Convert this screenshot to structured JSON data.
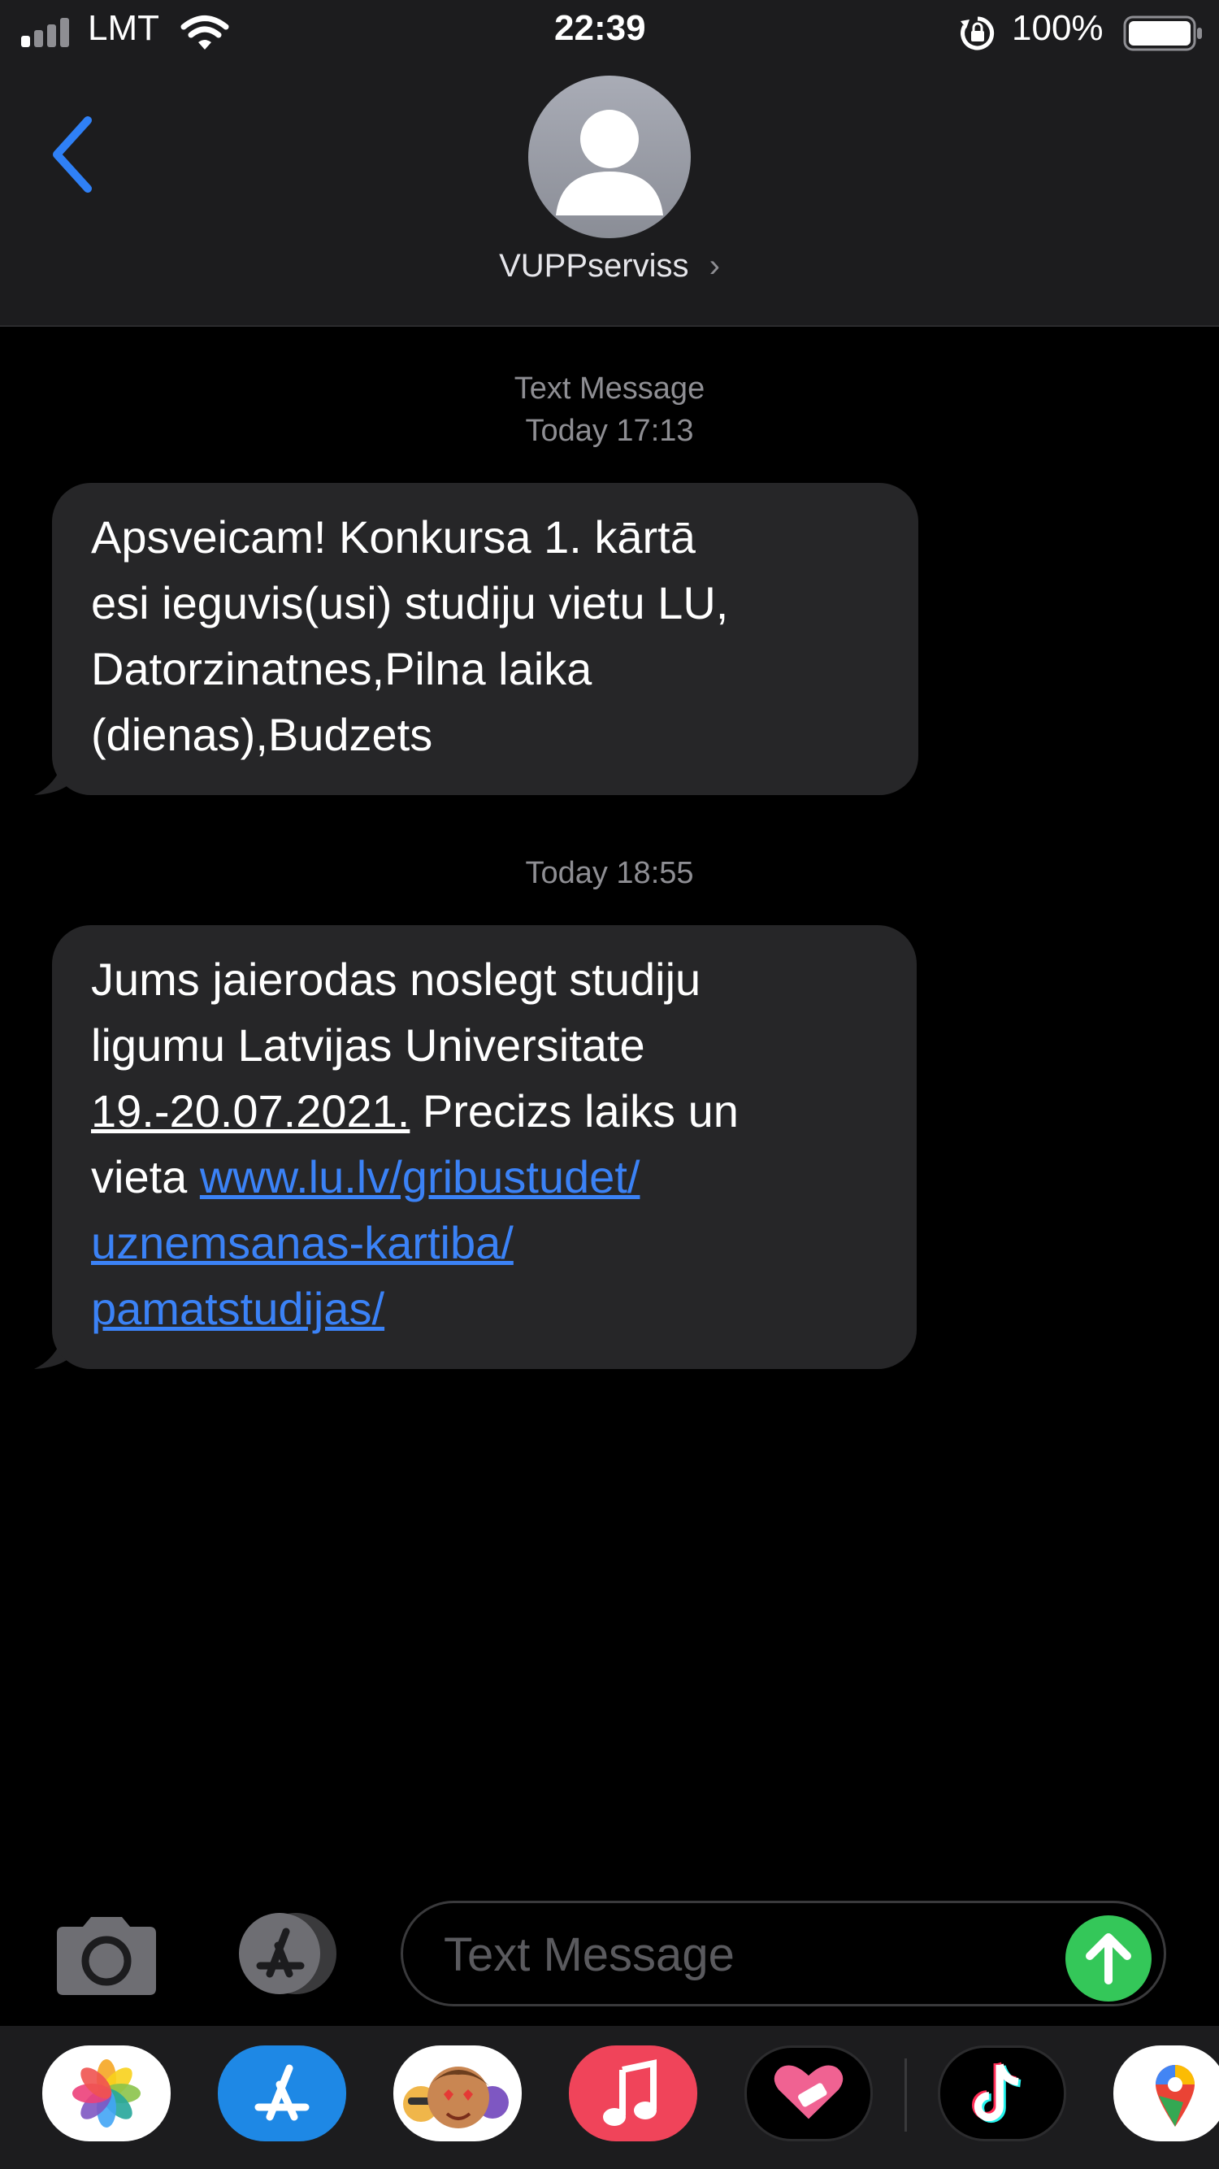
{
  "status_bar": {
    "carrier": "LMT",
    "time": "22:39",
    "battery": "100%"
  },
  "header": {
    "contact_name": "VUPPserviss",
    "chevron": "›"
  },
  "conversation": {
    "group1": {
      "label": "Text Message",
      "time": "Today 17:13"
    },
    "message1": {
      "lines": [
        "Apsveicam! Konkursa 1. kārtā",
        "esi ieguvis(usi) studiju vietu LU,",
        "Datorzinatnes,Pilna laika",
        "(dienas),Budzets"
      ]
    },
    "group2": {
      "time": "Today 18:55"
    },
    "message2": {
      "line1": "Jums jaierodas noslegt studiju",
      "line2": "ligumu Latvijas Universitate",
      "date": "19.-20.07.2021.",
      "line3_rest": " Precizs laiks un",
      "line4_prefix": "vieta ",
      "link_part1": "www.lu.lv/gribustudet/",
      "link_part2": "uznemsanas-kartiba/",
      "link_part3": "pamatstudijas/"
    }
  },
  "input_bar": {
    "placeholder": "Text Message",
    "camera_icon": "camera-icon",
    "apps_icon": "app-store-icon",
    "send_icon": "arrow-up-icon"
  },
  "app_drawer": {
    "apps": [
      "photos",
      "app-store",
      "memoji",
      "music",
      "heart-app",
      "tiktok",
      "maps"
    ]
  },
  "colors": {
    "bubble": "#262628",
    "link": "#3b82f6",
    "send": "#34c759",
    "back": "#2f80f6"
  }
}
